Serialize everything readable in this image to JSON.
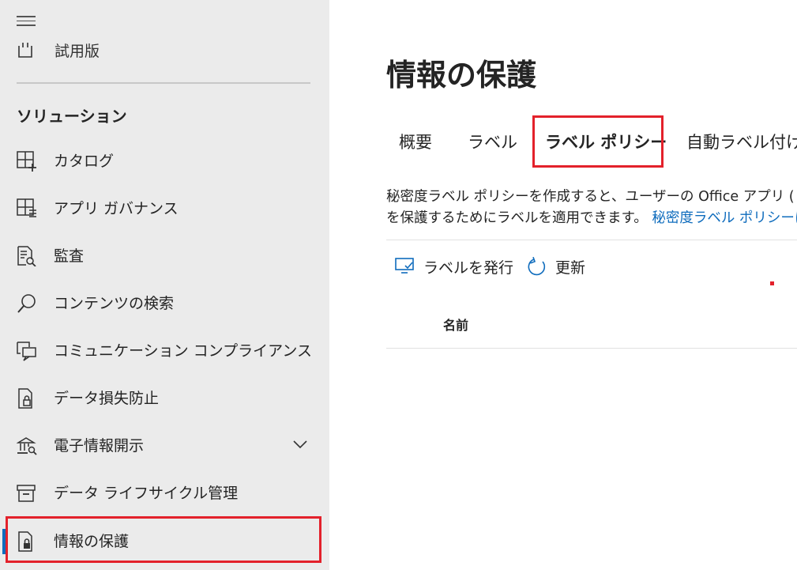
{
  "sidebar": {
    "trial_label": "試用版",
    "section_title": "ソリューション",
    "items": [
      {
        "label": "カタログ",
        "icon": "catalog-icon"
      },
      {
        "label": "アプリ ガバナンス",
        "icon": "app-governance-icon"
      },
      {
        "label": "監査",
        "icon": "audit-icon"
      },
      {
        "label": "コンテンツの検索",
        "icon": "search-icon"
      },
      {
        "label": "コミュニケーション コンプライアンス",
        "icon": "communication-compliance-icon"
      },
      {
        "label": "データ損失防止",
        "icon": "dlp-icon"
      },
      {
        "label": "電子情報開示",
        "icon": "ediscovery-icon"
      },
      {
        "label": "データ ライフサイクル管理",
        "icon": "archive-icon"
      },
      {
        "label": "情報の保護",
        "icon": "info-protection-icon"
      }
    ]
  },
  "main": {
    "title": "情報の保護",
    "tabs": [
      "概要",
      "ラベル",
      "ラベル ポリシー",
      "自動ラベル付け"
    ],
    "active_tab": "ラベル ポリシー",
    "desc_line1": "秘密度ラベル ポリシーを作成すると、ユーザーの Office アプリ (",
    "desc_line2": "を保護するためにラベルを適用できます。",
    "desc_link": "秘密度ラベル ポリシーに",
    "commands": {
      "publish": "ラベルを発行",
      "refresh": "更新"
    },
    "column_name": "名前"
  },
  "colors": {
    "accent": "#0f6cbd",
    "highlight": "#e3212b",
    "sidebar_bg": "#ebebeb"
  }
}
